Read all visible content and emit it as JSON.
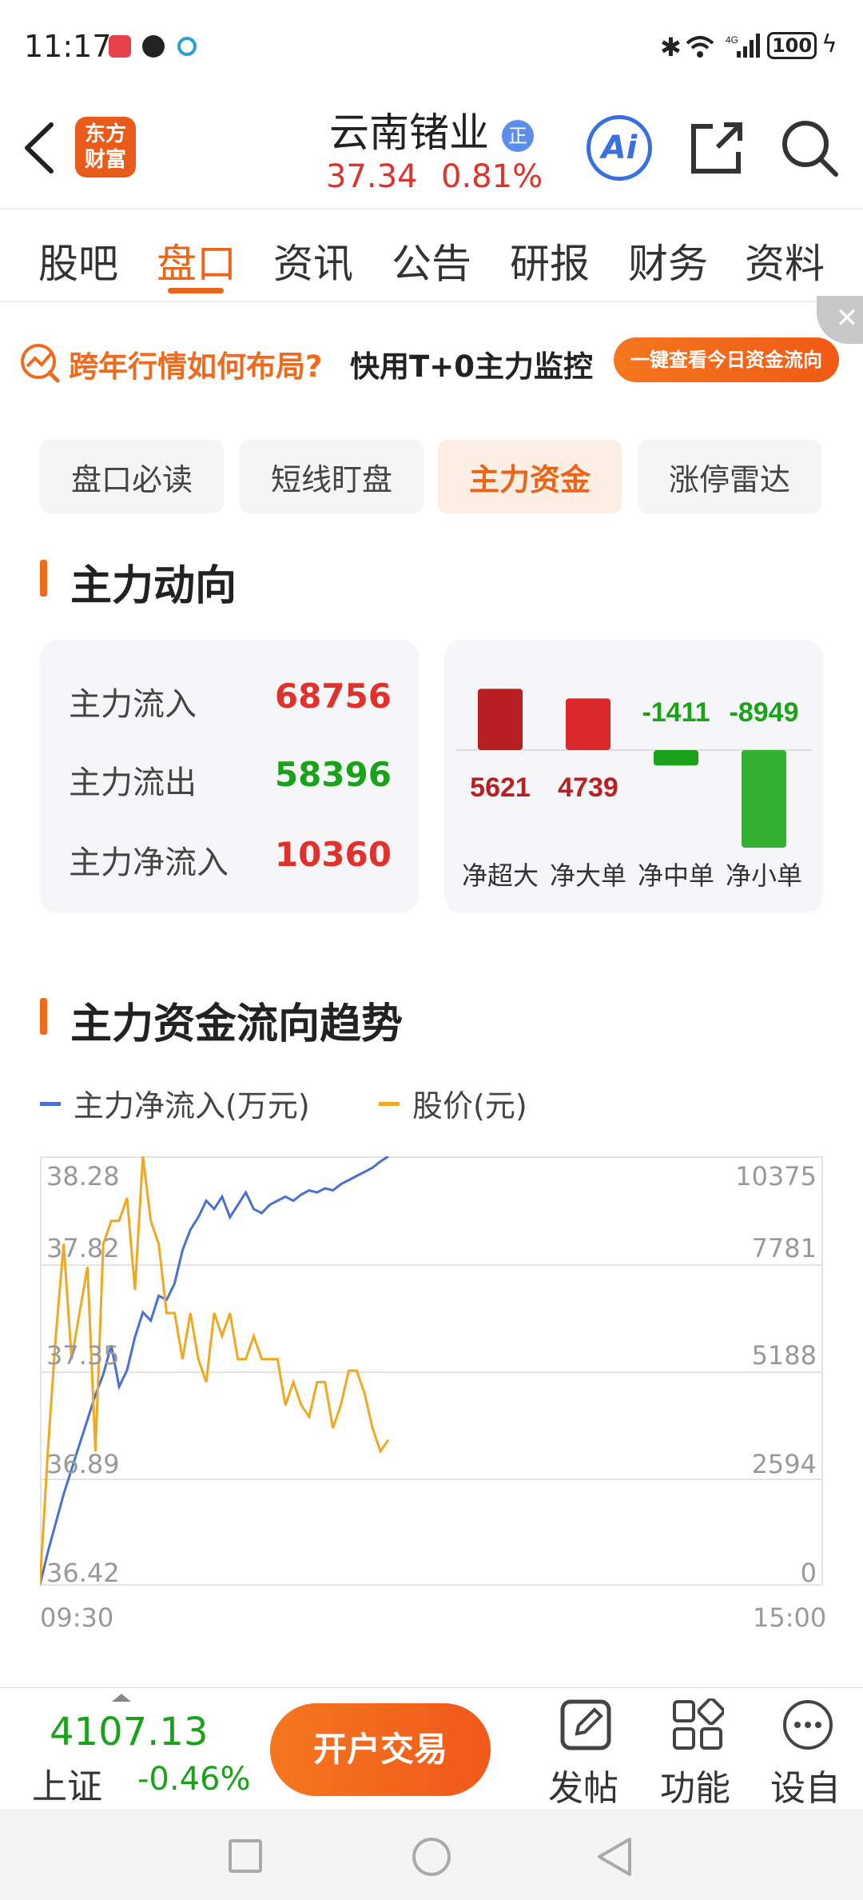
{
  "status_bar": {
    "time": "11:17",
    "battery": "100"
  },
  "header": {
    "title": "云南锗业",
    "badge": "正",
    "price": "37.34",
    "change_pct": "0.81%",
    "logo_line1": "东方",
    "logo_line2": "财富",
    "ai_label": "Ai"
  },
  "tabs": [
    "股吧",
    "盘口",
    "资讯",
    "公告",
    "研报",
    "财务",
    "资料"
  ],
  "banner": {
    "text_orange": "跨年行情如何布局?",
    "text_black": "快用T+0主力监控",
    "button": "一键查看今日资金流向"
  },
  "subtabs": [
    "盘口必读",
    "短线盯盘",
    "主力资金",
    "涨停雷达"
  ],
  "main_flow": {
    "title": "主力动向",
    "rows": [
      {
        "label": "主力流入",
        "value": "68756",
        "color": "#e0312b"
      },
      {
        "label": "主力流出",
        "value": "58396",
        "color": "#1aa31a"
      },
      {
        "label": "主力净流入",
        "value": "10360",
        "color": "#e0312b"
      }
    ]
  },
  "chart_data": [
    {
      "type": "bar",
      "categories": [
        "净超大",
        "净大单",
        "净中单",
        "净小单"
      ],
      "values": [
        5621,
        4739,
        -1411,
        -8949
      ],
      "value_labels": [
        "5621",
        "4739",
        "-1411",
        "-8949"
      ],
      "colors": [
        "#b81f22",
        "#d9272a",
        "#1aa31a",
        "#31b031"
      ]
    },
    {
      "type": "line",
      "title": "主力资金流向趋势",
      "x_start": "09:30",
      "x_end": "15:00",
      "left_ticks": [
        "38.28",
        "37.82",
        "37.35",
        "36.89",
        "36.42"
      ],
      "right_ticks": [
        "10375",
        "7781",
        "5188",
        "2594",
        "0"
      ],
      "ylim_left": [
        36.42,
        38.28
      ],
      "ylim_right": [
        0,
        10375
      ],
      "series": [
        {
          "name": "主力净流入(万元)",
          "axis": "right",
          "color": "#4a6fd4",
          "values": [
            0,
            800,
            1500,
            2200,
            2800,
            3400,
            4000,
            4600,
            5100,
            5800,
            4800,
            5200,
            6000,
            6600,
            6400,
            7000,
            6900,
            7300,
            8100,
            8600,
            8900,
            9300,
            9100,
            9400,
            8900,
            9200,
            9500,
            9100,
            9000,
            9200,
            9300,
            9400,
            9300,
            9450,
            9550,
            9500,
            9600,
            9550,
            9700,
            9800,
            9900,
            10000,
            10100,
            10250,
            10375
          ]
        },
        {
          "name": "股价(元)",
          "axis": "left",
          "color": "#f0a820",
          "values": [
            36.42,
            37.0,
            37.5,
            37.9,
            37.4,
            37.6,
            37.8,
            37.0,
            37.9,
            38.0,
            38.0,
            38.1,
            37.7,
            38.28,
            38.0,
            37.9,
            37.6,
            37.6,
            37.4,
            37.6,
            37.4,
            37.3,
            37.6,
            37.5,
            37.6,
            37.4,
            37.4,
            37.5,
            37.4,
            37.4,
            37.4,
            37.2,
            37.3,
            37.2,
            37.15,
            37.3,
            37.3,
            37.1,
            37.2,
            37.35,
            37.35,
            37.25,
            37.1,
            37.0,
            37.05
          ]
        }
      ]
    }
  ],
  "bottom_bar": {
    "index_value": "4107.13",
    "index_name": "上证",
    "index_change": "-0.46%",
    "trade_button": "开户交易",
    "nav": [
      "发帖",
      "功能",
      "设自"
    ]
  }
}
